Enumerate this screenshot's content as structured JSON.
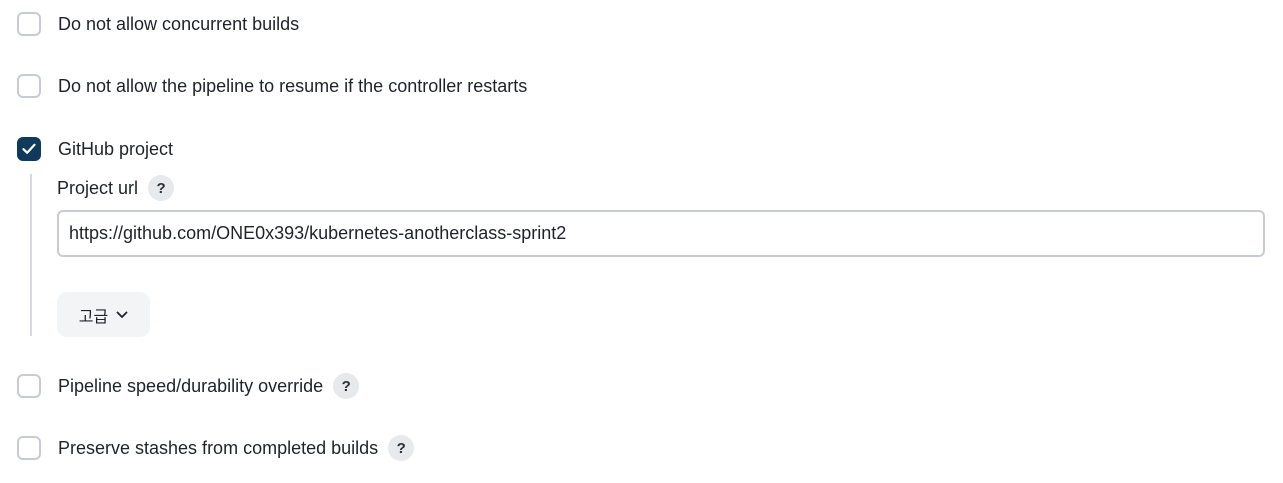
{
  "options": {
    "concurrent": {
      "label": "Do not allow concurrent builds",
      "checked": false
    },
    "resume": {
      "label": "Do not allow the pipeline to resume if the controller restarts",
      "checked": false
    },
    "github": {
      "label": "GitHub project",
      "checked": true
    },
    "speed": {
      "label": "Pipeline speed/durability override",
      "checked": false
    },
    "stashes": {
      "label": "Preserve stashes from completed builds",
      "checked": false
    }
  },
  "github_project": {
    "url_label": "Project url",
    "url_value": "https://github.com/ONE0x393/kubernetes-anotherclass-sprint2",
    "advanced_label": "고급"
  },
  "help_glyph": "?",
  "colors": {
    "checked_fill": "#0f3a5c",
    "checkbox_border": "#c8ccd2",
    "help_bg": "#e8e9eb"
  }
}
